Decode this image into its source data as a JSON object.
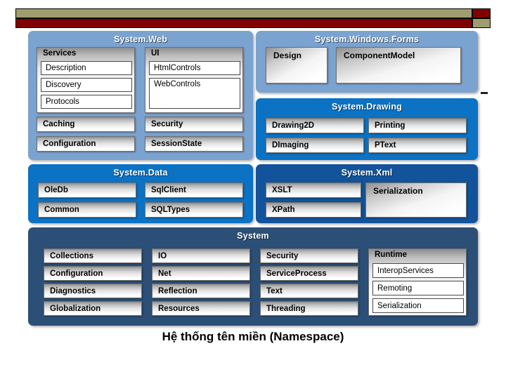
{
  "banner": {
    "olive_color": "#9f9d6e",
    "maroon_color": "#800000"
  },
  "caption": "Hệ thống tên miền (Namespace)",
  "panels": {
    "web": {
      "title": "System.Web",
      "color": "#7ba3d0",
      "groups": [
        {
          "title": "Services",
          "items": [
            "Description",
            "Discovery",
            "Protocols"
          ]
        },
        {
          "title": "UI",
          "items": [
            "HtmlControls",
            "WebControls"
          ]
        }
      ],
      "chips_left": [
        "Caching",
        "Configuration"
      ],
      "chips_right": [
        "Security",
        "SessionState"
      ]
    },
    "winforms": {
      "title": "System.Windows.Forms",
      "color": "#7ba3d0",
      "chips": [
        "Design",
        "ComponentModel"
      ]
    },
    "drawing": {
      "title": "System.Drawing",
      "color": "#0b72c4",
      "chips_left": [
        "Drawing2D",
        "DImaging"
      ],
      "chips_right": [
        "Printing",
        "PText"
      ]
    },
    "data": {
      "title": "System.Data",
      "color": "#0b72c4",
      "chips_left": [
        "OleDb",
        "Common"
      ],
      "chips_right": [
        "SqlClient",
        "SQLTypes"
      ]
    },
    "xml": {
      "title": "System.Xml",
      "color": "#12539b",
      "chips_left": [
        "XSLT",
        "XPath"
      ],
      "chips_right": [
        "Serialization"
      ]
    },
    "system": {
      "title": "System",
      "color": "#2c4f77",
      "col1": [
        "Collections",
        "Configuration",
        "Diagnostics",
        "Globalization"
      ],
      "col2": [
        "IO",
        "Net",
        "Reflection",
        "Resources"
      ],
      "col3": [
        "Security",
        "ServiceProcess",
        "Text",
        "Threading"
      ],
      "runtime": {
        "title": "Runtime",
        "items": [
          "InteropServices",
          "Remoting",
          "Serialization"
        ]
      }
    }
  }
}
